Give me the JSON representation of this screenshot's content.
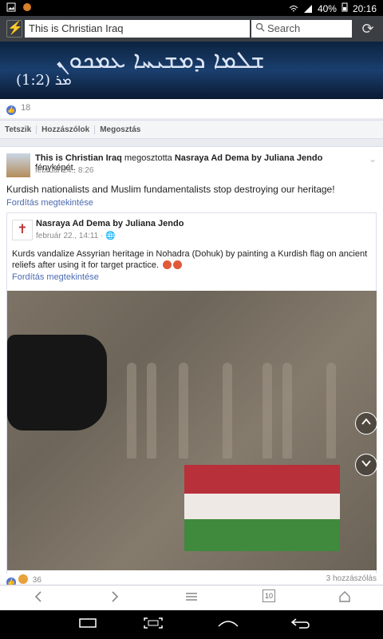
{
  "statusbar": {
    "battery": "40%",
    "time": "20:16"
  },
  "browser": {
    "url": "This is Christian Iraq",
    "search_placeholder": "Search"
  },
  "banner": {
    "script_text": "ܫܠܡܐ ܕܡܫܝܚܐ ܥܡܟܘܢ",
    "reference": "ܡܪ (1:2)"
  },
  "page_post": {
    "like_count": "18",
    "actions": [
      "Tetszik",
      "Hozzászólok",
      "Megosztás"
    ]
  },
  "post": {
    "author": "This is Christian Iraq",
    "shared_word": "megosztotta",
    "source": "Nasraya Ad Dema by Juliana Jendo",
    "object": "fényképét.",
    "date": "február 24., 8:26",
    "text": "Kurdish nationalists and Muslim fundamentalists stop destroying our heritage!",
    "translate_label": "Fordítás megtekintése",
    "shared": {
      "author": "Nasraya Ad Dema by Juliana Jendo",
      "date": "február 22., 14:11",
      "text": "Kurds vandalize Assyrian heritage in Nohadra (Dohuk) by painting a Kurdish flag on ancient reliefs after using it for target practice.",
      "translate_label": "Fordítás megtekintése"
    },
    "reaction_count": "36",
    "comment_count": "3 hozzászólás"
  },
  "bottomnav": {
    "tab_count": "10"
  },
  "icons": {
    "lightning": "lightning-icon",
    "search": "search-icon",
    "reload": "reload-icon",
    "back": "chevron-left-icon",
    "forward": "chevron-right-icon",
    "menu": "menu-icon",
    "tabs": "tabs-icon",
    "home": "home-icon"
  },
  "colors": {
    "link": "#4b6ab0",
    "like_blue": "#4a76d9",
    "toolbar": "#3b3f44"
  }
}
